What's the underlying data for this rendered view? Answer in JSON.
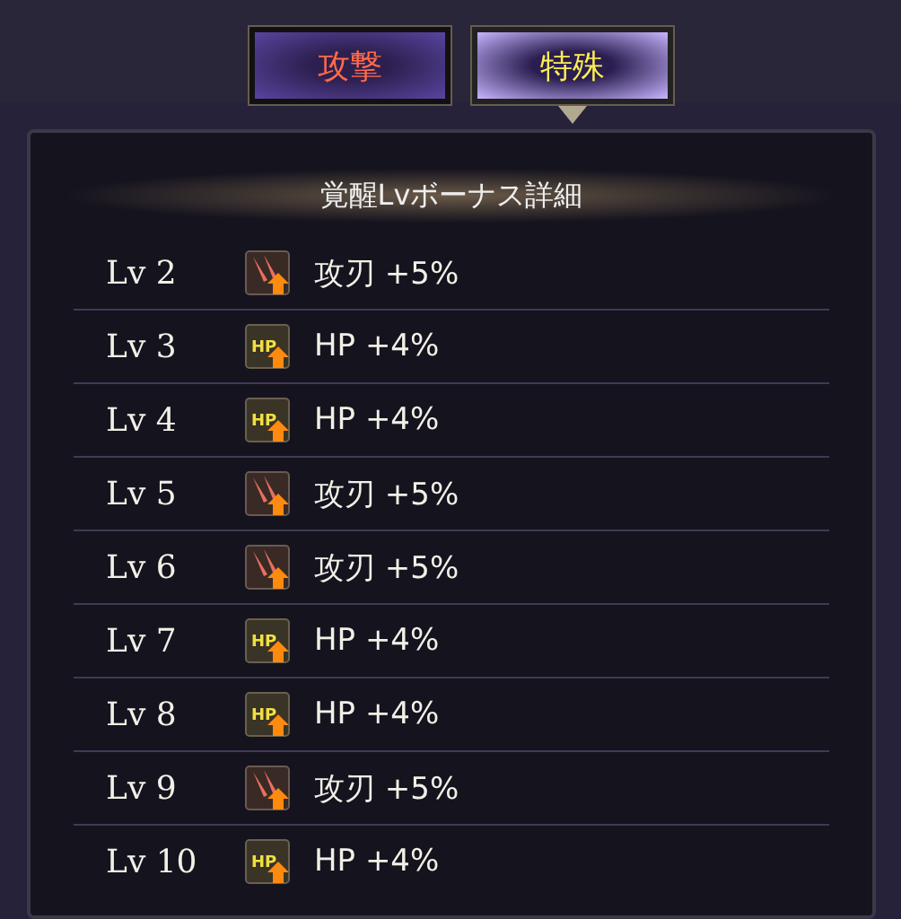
{
  "tabs": [
    {
      "label": "攻撃",
      "selected": false
    },
    {
      "label": "特殊",
      "selected": true
    }
  ],
  "panel": {
    "title": "覚醒Lvボーナス詳細",
    "rows": [
      {
        "level": "Lv 2",
        "kind": "attack",
        "bonus": "攻刃 +5%"
      },
      {
        "level": "Lv 3",
        "kind": "hp",
        "icon_text": "HP",
        "bonus": "HP +4%"
      },
      {
        "level": "Lv 4",
        "kind": "hp",
        "icon_text": "HP",
        "bonus": "HP +4%"
      },
      {
        "level": "Lv 5",
        "kind": "attack",
        "bonus": "攻刃 +5%"
      },
      {
        "level": "Lv 6",
        "kind": "attack",
        "bonus": "攻刃 +5%"
      },
      {
        "level": "Lv 7",
        "kind": "hp",
        "icon_text": "HP",
        "bonus": "HP +4%"
      },
      {
        "level": "Lv 8",
        "kind": "hp",
        "icon_text": "HP",
        "bonus": "HP +4%"
      },
      {
        "level": "Lv 9",
        "kind": "attack",
        "bonus": "攻刃 +5%"
      },
      {
        "level": "Lv 10",
        "kind": "hp",
        "icon_text": "HP",
        "bonus": "HP +4%"
      }
    ]
  }
}
